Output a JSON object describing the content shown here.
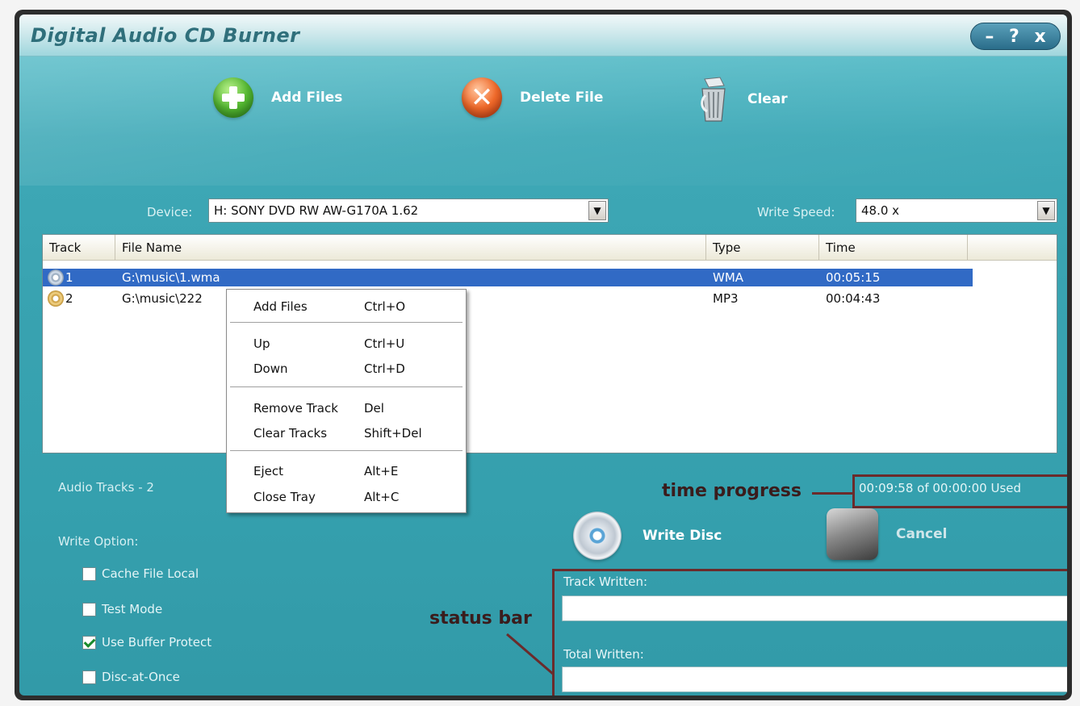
{
  "window": {
    "title": "Digital Audio CD Burner",
    "controls": {
      "minimize": "–",
      "help": "?",
      "close": "x"
    }
  },
  "toolbar": {
    "add_files": "Add Files",
    "delete_file": "Delete File",
    "clear": "Clear"
  },
  "device": {
    "label": "Device:",
    "value": "H: SONY DVD RW AW-G170A 1.62"
  },
  "write_speed": {
    "label": "Write Speed:",
    "value": "48.0 x"
  },
  "track_list": {
    "columns": [
      "Track",
      "File Name",
      "Type",
      "Time"
    ],
    "rows": [
      {
        "track": "1",
        "file_name": "G:\\music\\1.wma",
        "type": "WMA",
        "time": "00:05:15",
        "selected": true
      },
      {
        "track": "2",
        "file_name": "G:\\music\\222",
        "type": "MP3",
        "time": "00:04:43",
        "selected": false
      }
    ]
  },
  "context_menu": {
    "items": [
      {
        "label": "Add Files",
        "shortcut": "Ctrl+O"
      },
      {
        "label": "Up",
        "shortcut": "Ctrl+U"
      },
      {
        "label": "Down",
        "shortcut": "Ctrl+D"
      },
      {
        "label": "Remove Track",
        "shortcut": "Del"
      },
      {
        "label": "Clear Tracks",
        "shortcut": "Shift+Del"
      },
      {
        "label": "Eject",
        "shortcut": "Alt+E"
      },
      {
        "label": "Close Tray",
        "shortcut": "Alt+C"
      }
    ]
  },
  "summary": {
    "audio_tracks": "Audio Tracks - 2",
    "time_used": "00:09:58 of 00:00:00 Used"
  },
  "write_options": {
    "label": "Write Option:",
    "options": [
      {
        "label": "Cache File Local",
        "checked": false
      },
      {
        "label": "Test Mode",
        "checked": false
      },
      {
        "label": "Use Buffer Protect",
        "checked": true
      },
      {
        "label": "Disc-at-Once",
        "checked": false
      }
    ]
  },
  "actions": {
    "write_disc": "Write Disc",
    "cancel": "Cancel"
  },
  "status": {
    "track_written_label": "Track Written:",
    "total_written_label": "Total Written:"
  },
  "annotations": {
    "time_progress": "time progress",
    "status_bar": "status bar"
  },
  "colors": {
    "accent": "#3fa9b7",
    "selection": "#316ac5",
    "annotation": "#6b2b2b"
  }
}
